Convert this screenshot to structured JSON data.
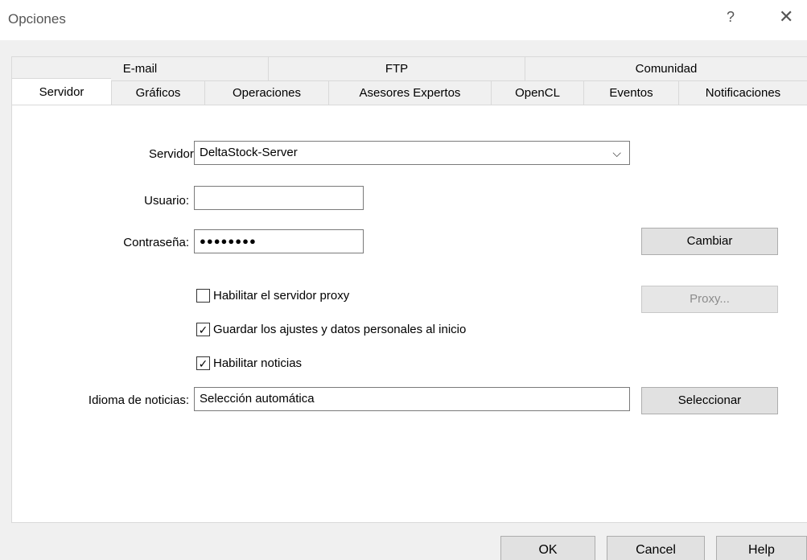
{
  "window": {
    "title": "Opciones",
    "help_glyph": "?",
    "close_glyph": "✕"
  },
  "tabs_back": [
    "E-mail",
    "FTP",
    "Comunidad"
  ],
  "tabs_front": [
    "Servidor",
    "Gráficos",
    "Operaciones",
    "Asesores Expertos",
    "OpenCL",
    "Eventos",
    "Notificaciones"
  ],
  "active_tab": "Servidor",
  "form": {
    "server_label": "Servidor:",
    "server_value": "DeltaStock-Server",
    "user_label": "Usuario:",
    "user_value": "",
    "password_label": "Contraseña:",
    "password_value": "●●●●●●●●",
    "change_button": "Cambiar",
    "proxy_checkbox_label": "Habilitar el servidor proxy",
    "proxy_checked": false,
    "proxy_button": "Proxy...",
    "save_checkbox_label": "Guardar los ajustes y datos personales al inicio",
    "save_checked": true,
    "news_checkbox_label": "Habilitar noticias",
    "news_checked": true,
    "news_lang_label": "Idioma de noticias:",
    "news_lang_value": "Selección automática",
    "select_button": "Seleccionar",
    "check_glyph": "✓",
    "chevron_glyph": "⌵"
  },
  "buttons": {
    "ok": "OK",
    "cancel": "Cancel",
    "help": "Help"
  },
  "colors": {
    "panel_bg": "#ffffff",
    "window_bg": "#f0f0f0",
    "button_bg": "#e1e1e1",
    "disabled_text": "#8c8c8c"
  }
}
